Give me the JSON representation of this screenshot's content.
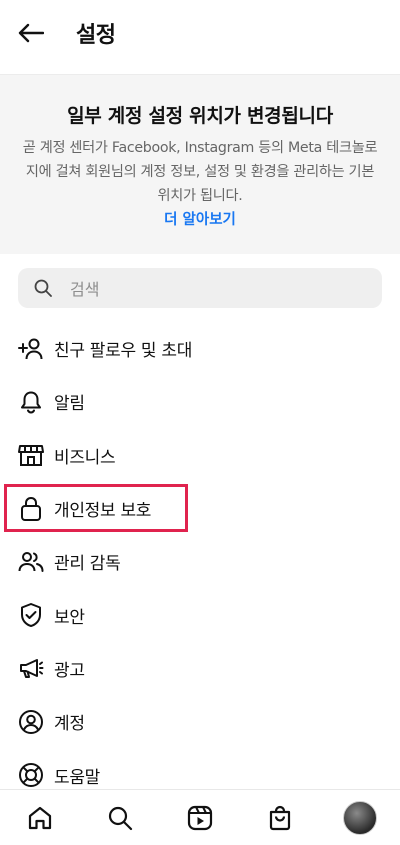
{
  "header": {
    "title": "설정",
    "back_icon": "back-arrow-icon"
  },
  "notice": {
    "title": "일부 계정 설정 위치가 변경됩니다",
    "body": "곧 계정 센터가 Facebook, Instagram 등의 Meta 테크놀로지에 걸쳐 회원님의 계정 정보, 설정 및 환경을 관리하는 기본 위치가 됩니다.",
    "link": "더 알아보기",
    "link_color": "#1877f2"
  },
  "search": {
    "placeholder": "검색",
    "icon": "search-icon"
  },
  "menu": {
    "items": [
      {
        "label": "친구 팔로우 및 초대",
        "icon": "add-person-icon"
      },
      {
        "label": "알림",
        "icon": "bell-icon"
      },
      {
        "label": "비즈니스",
        "icon": "shop-icon"
      },
      {
        "label": "개인정보 보호",
        "icon": "lock-icon",
        "highlighted": true
      },
      {
        "label": "관리 감독",
        "icon": "people-icon"
      },
      {
        "label": "보안",
        "icon": "shield-icon"
      },
      {
        "label": "광고",
        "icon": "megaphone-icon"
      },
      {
        "label": "계정",
        "icon": "user-circle-icon"
      },
      {
        "label": "도움말",
        "icon": "lifebuoy-icon"
      }
    ]
  },
  "highlight_color": "#e0234e",
  "bottom_nav": [
    {
      "name": "home",
      "icon": "home-icon"
    },
    {
      "name": "search",
      "icon": "search-icon"
    },
    {
      "name": "reels",
      "icon": "reels-icon"
    },
    {
      "name": "shop",
      "icon": "shopping-bag-icon"
    },
    {
      "name": "profile",
      "icon": "avatar"
    }
  ]
}
